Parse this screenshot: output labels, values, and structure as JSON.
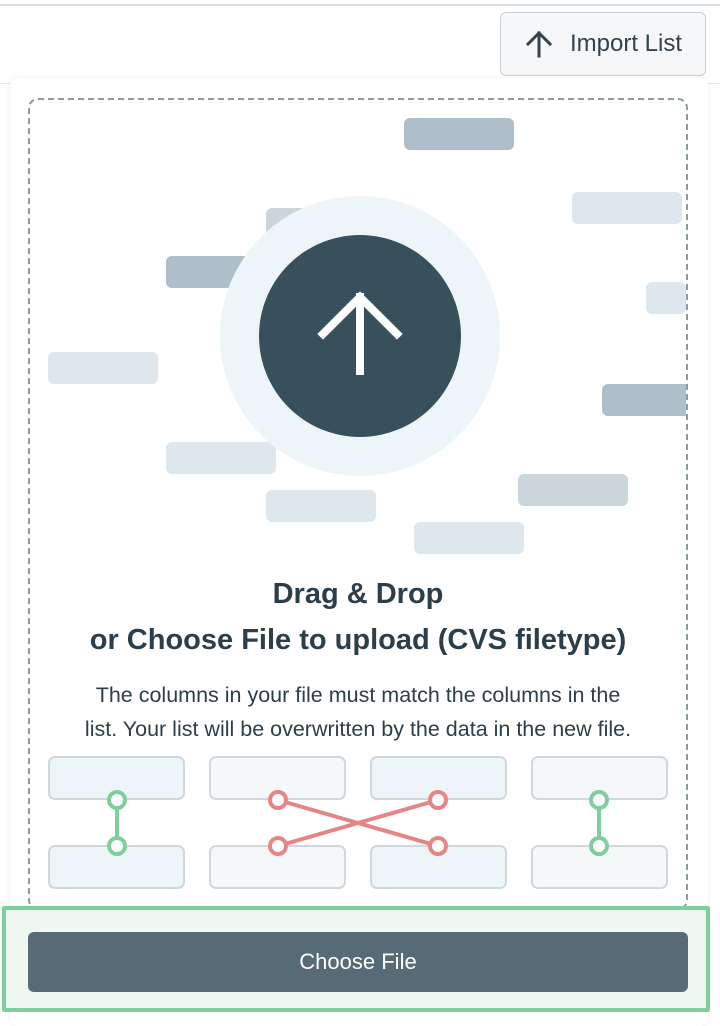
{
  "header": {
    "import_button": {
      "label": "Import List",
      "icon": "arrow-up-icon"
    }
  },
  "dropzone": {
    "upload_icon": "arrow-up-icon",
    "title_line1": "Drag & Drop",
    "title_line2": "or Choose File to upload (CVS filetype)",
    "description_line1": "The columns in your file must match the columns in the",
    "description_line2": "list. Your list will be overwritten by the data in the new file."
  },
  "footer": {
    "choose_button": {
      "label": "Choose File"
    }
  },
  "colors": {
    "accent_dark": "#37505b",
    "button": "#566b75",
    "match_green": "#7fcf9e",
    "mismatch_red": "#e68585",
    "highlight_frame": "#7fcf9e"
  }
}
